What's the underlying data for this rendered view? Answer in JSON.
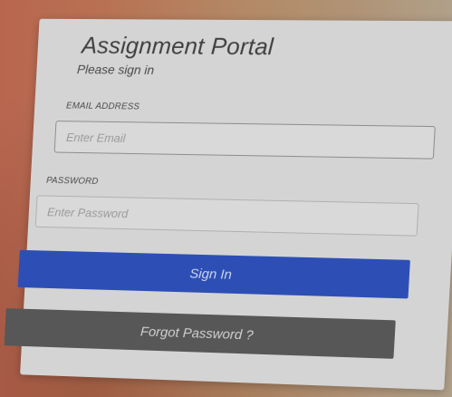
{
  "page": {
    "title": "Assignment Portal",
    "subtitle": "Please sign in"
  },
  "form": {
    "email": {
      "label": "EMAIL ADDRESS",
      "placeholder": "Enter Email",
      "value": ""
    },
    "password": {
      "label": "PASSWORD",
      "placeholder": "Enter Password",
      "value": ""
    },
    "signin_label": "Sign In",
    "forgot_label": "Forgot Password ?"
  },
  "colors": {
    "primary_button": "#2d4fb5",
    "secondary_button": "#575757",
    "card": "#d4d4d4"
  }
}
